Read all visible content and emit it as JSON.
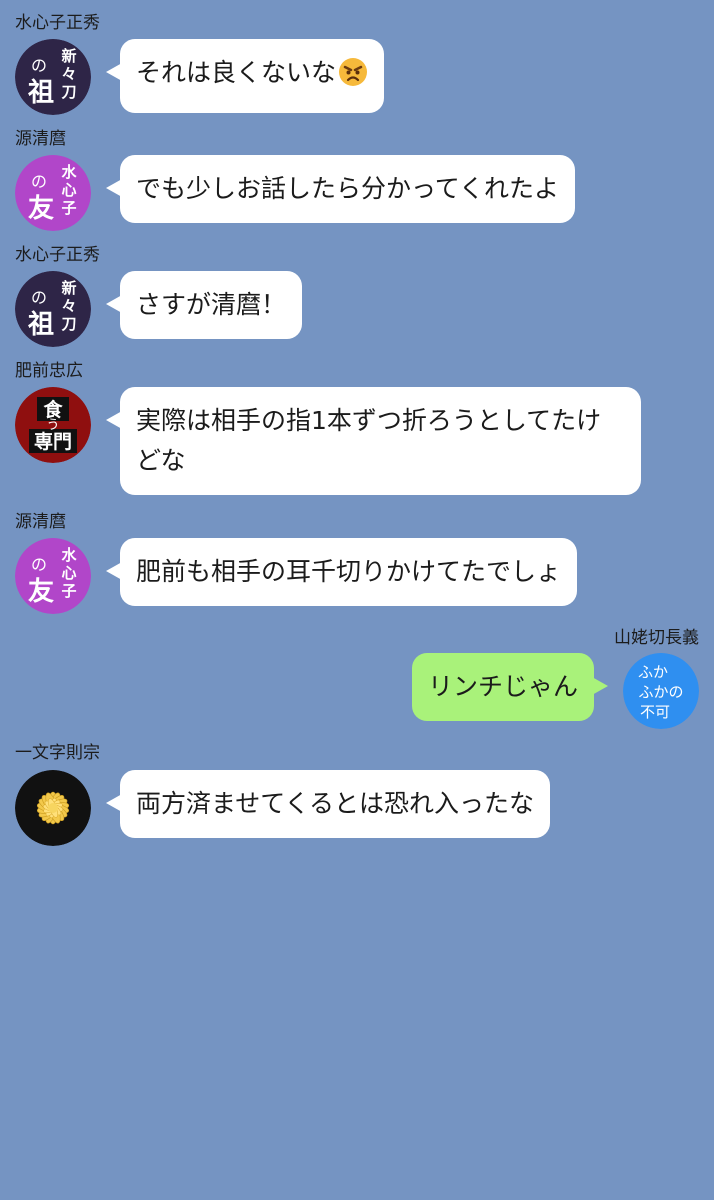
{
  "messages": [
    {
      "sender": "水心子正秀",
      "text": "それは良くないな",
      "emoji": "angry-face",
      "side": "left"
    },
    {
      "sender": "源清麿",
      "text": "でも少しお話したら分かってくれたよ",
      "side": "left"
    },
    {
      "sender": "水心子正秀",
      "text": "さすが清麿！",
      "side": "left"
    },
    {
      "sender": "肥前忠広",
      "text": "実際は相手の指1本ずつ折ろうとしてたけどな",
      "side": "left"
    },
    {
      "sender": "源清麿",
      "text": "肥前も相手の耳千切りかけてたでしょ",
      "side": "left"
    },
    {
      "sender": "山姥切長義",
      "text": "リンチじゃん",
      "side": "right"
    },
    {
      "sender": "一文字則宗",
      "text": "両方済ませてくるとは恐れ入ったな",
      "side": "left"
    }
  ],
  "avatars": {
    "suishinshi": {
      "line1": "新",
      "line2": "々",
      "line3": "刀",
      "small": "の",
      "big": "祖",
      "color": "#2e2547"
    },
    "kiyomaro": {
      "line1": "水",
      "line2": "心",
      "line3": "子",
      "small": "の",
      "big": "友",
      "color": "#b146c9"
    },
    "hizen": {
      "top": "食",
      "mid": "う",
      "bottom": "専門",
      "color": "#8f0f0f"
    },
    "chougi": {
      "row1": "ふか",
      "row2": "ふかの",
      "row3": "不可",
      "color": "#2f8ff0"
    },
    "norimune": {
      "icon": "chrysanthemum-icon",
      "color": "#111111"
    }
  },
  "colors": {
    "background": "#7594c2",
    "bubble_left": "#ffffff",
    "bubble_right": "#a9f27a"
  }
}
